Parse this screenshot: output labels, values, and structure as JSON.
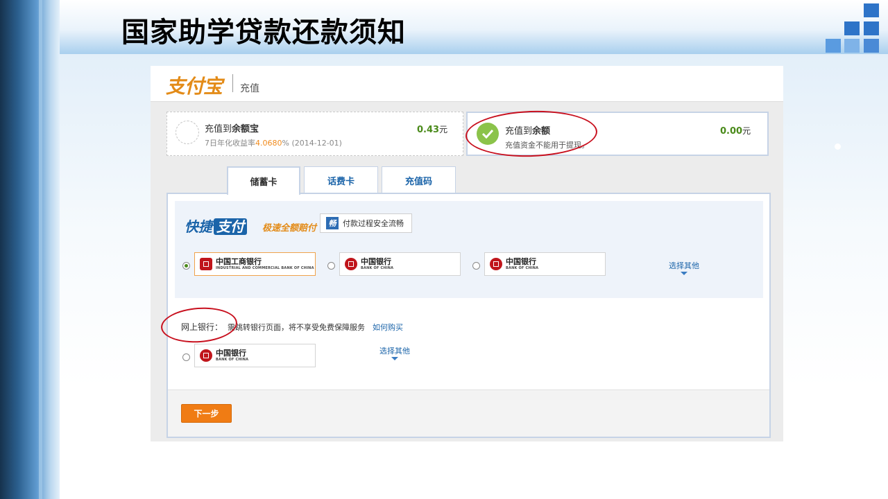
{
  "slide": {
    "title": "国家助学贷款还款须知"
  },
  "header": {
    "logo_text": "支付宝",
    "page_label": "充值"
  },
  "cards": [
    {
      "title_prefix": "充值到",
      "title_bold": "余额宝",
      "sub_prefix": "7日年化收益率",
      "sub_rate": "4.0680",
      "sub_suffix": "% (2014-12-01)",
      "amount": "0.43",
      "unit": "元",
      "selected": false
    },
    {
      "title_prefix": "充值到",
      "title_bold": "余额",
      "sub": "充值资金不能用于提现。",
      "amount": "0.00",
      "unit": "元",
      "selected": true
    }
  ],
  "tabs": [
    "储蓄卡",
    "话费卡",
    "充值码"
  ],
  "active_tab": 0,
  "quick_pay": {
    "logo_a": "快捷",
    "logo_b": "支付",
    "slogan": "极速全额赔付",
    "badge_icon": "畅",
    "badge_text": "付款过程安全流畅",
    "banks": [
      {
        "name": "中国工商银行",
        "en": "INDUSTRIAL AND COMMERCIAL BANK OF CHINA",
        "selected": true
      },
      {
        "name": "中国银行",
        "en": "BANK OF CHINA",
        "selected": false
      },
      {
        "name": "中国银行",
        "en": "BANK OF CHINA",
        "selected": false
      }
    ],
    "more_label": "选择其他"
  },
  "online_bank": {
    "label": "网上银行：",
    "note": "需跳转银行页面，将不享受免费保障服务",
    "link": "如何购买",
    "banks": [
      {
        "name": "中国银行",
        "en": "BANK OF CHINA",
        "selected": false
      }
    ],
    "more_label": "选择其他"
  },
  "footer": {
    "next_label": "下一步"
  },
  "colors": {
    "brand_orange": "#f07c14",
    "link_blue": "#1b64a9",
    "amount_green": "#4a8a1a",
    "annotation_red": "#c8101e"
  }
}
